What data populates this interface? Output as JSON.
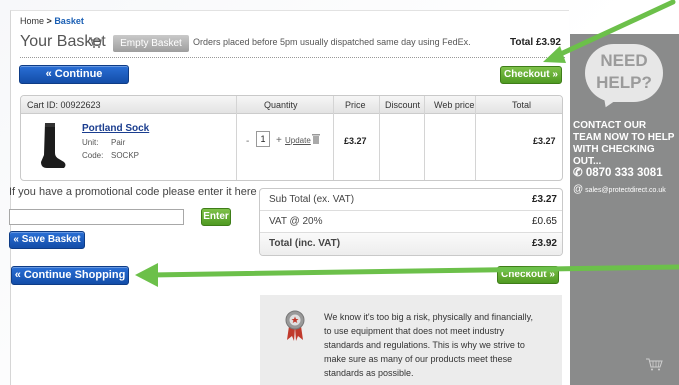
{
  "breadcrumb": {
    "home": "Home",
    "sep": ">",
    "current": "Basket"
  },
  "header": {
    "title": "Your Basket",
    "empty_basket": "Empty Basket",
    "dispatch_note": "Orders placed before 5pm usually dispatched same day using FedEx.",
    "total_label": "Total",
    "total_value": "£3.92"
  },
  "buttons": {
    "continue_shopping": "« Continue Shopping",
    "checkout": "Checkout »",
    "enter": "Enter",
    "save_basket": "« Save Basket"
  },
  "cart": {
    "cart_id": "Cart ID: 00922623",
    "columns": [
      "Quantity",
      "Price",
      "Discount",
      "Web price",
      "Total"
    ],
    "item": {
      "name": "Portland Sock",
      "unit_label": "Unit:",
      "unit_value": "Pair",
      "code_label": "Code:",
      "code_value": "SOCKP",
      "quantity": "1",
      "minus": "-",
      "plus": "+",
      "update": "Update",
      "price": "£3.27",
      "total": "£3.27"
    }
  },
  "promo": {
    "text": "If you have a promotional code please enter it here",
    "placeholder": ""
  },
  "totals": {
    "rows": [
      {
        "label": "Sub Total (ex. VAT)",
        "value": "£3.27"
      },
      {
        "label": "VAT @ 20%",
        "value": "£0.65"
      },
      {
        "label": "Total (inc. VAT)",
        "value": "£3.92"
      }
    ]
  },
  "info": {
    "text": "We know it's too big a risk, physically and financially, to use equipment that does not meet industry standards and regulations. This is why we strive to make sure as many of our products meet these standards as possible."
  },
  "sidebar": {
    "need": "NEED",
    "help": "HELP?",
    "contact": "CONTACT OUR TEAM NOW TO HELP WITH CHECKING OUT...",
    "phone": "0870 333 3081",
    "email": "sales@protectdirect.co.uk"
  },
  "colors": {
    "blue_button": "#1a5fc4",
    "green_button": "#5eab2f",
    "green_arrow": "#6cc04a",
    "sidebar_bg": "#8a8b8b"
  }
}
